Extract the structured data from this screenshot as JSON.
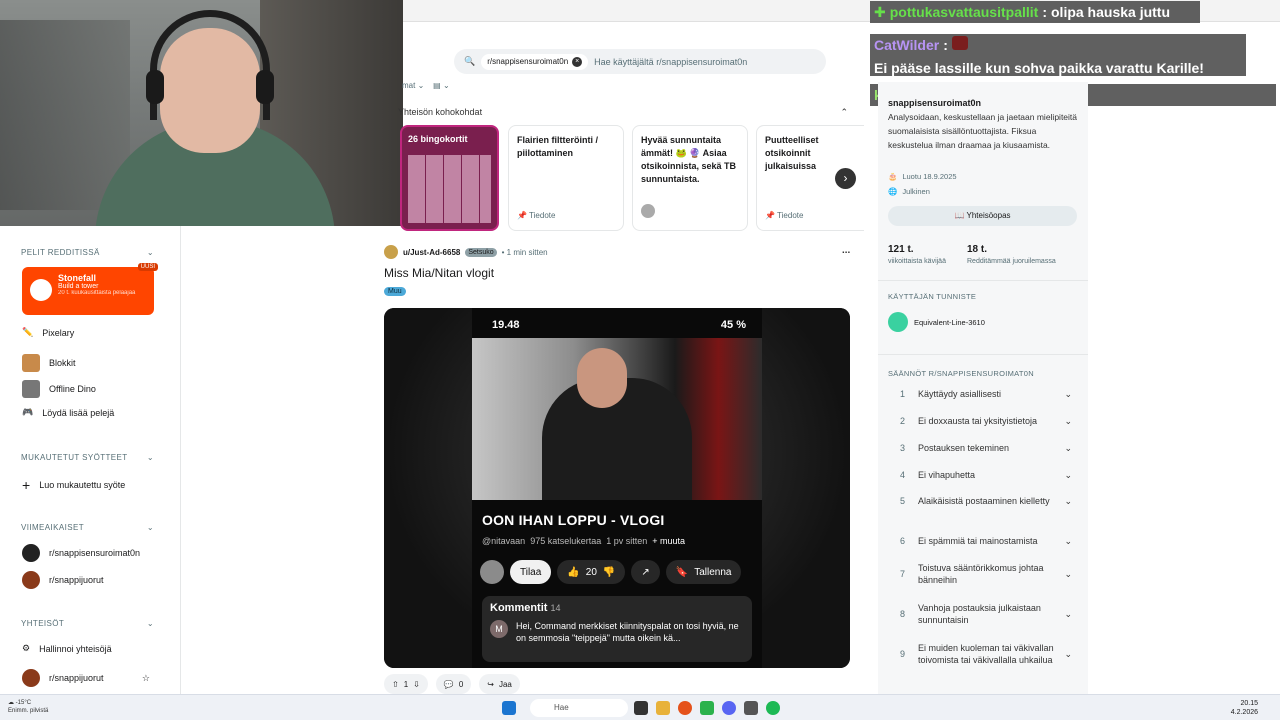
{
  "search": {
    "chip": "r/snappisensuroimat0n",
    "placeholder": "Hae käyttäjältä r/snappisensuroimat0n"
  },
  "chat": [
    {
      "user": "pottukasvattausitpallit",
      "text": "olipa hauska juttu",
      "color": "#66e04a"
    },
    {
      "user": "CatWilder",
      "text": "Ei pääse lassille kun sohva paikka varattu Karille!",
      "color": "#b794f4"
    },
    {
      "user": "kireeanaali",
      "text": "",
      "color": "#9ae66e"
    }
  ],
  "nav": {
    "games_head": "Pelit Redditissä",
    "stonefall": {
      "title": "Stonefall",
      "sub": "Build a tower",
      "count": "20 t. kuukausittaista pelaajaa",
      "badge": "UUSI"
    },
    "games": [
      "Pixelary",
      "Blokkit",
      "Offline Dino",
      "Löydä lisää pelejä"
    ],
    "custom_head": "Mukautetut syötteet",
    "custom_create": "Luo mukautettu syöte",
    "recent_head": "VIIMEAIKAISET",
    "recent": [
      "r/snappisensuroimat0n",
      "r/snappijuorut"
    ],
    "communities_head": "Yhteisöt",
    "communities": [
      "Hallinnoi yhteisöjä",
      "r/snappijuorut"
    ]
  },
  "feed": {
    "sort_label": "mat",
    "highlights_title": "Yhteisön kohokohdat",
    "highlights": [
      {
        "title": "26 bingokortit",
        "foot": ""
      },
      {
        "title": "Flairien filtteröinti / piilottaminen",
        "foot": "Tiedote"
      },
      {
        "title": "Hyvää sunnuntaita ämmät! 🐸 🔮 Asiaa otsikoinnista, sekä TB sunnuntaista.",
        "foot": ""
      },
      {
        "title": "Puutteelliset otsikoinnit julkaisuissa",
        "foot": "Tiedote"
      }
    ],
    "post": {
      "user": "u/Just-Ad-6658",
      "user_flair": "Setsuko",
      "time": "• 1 min sitten",
      "title": "Miss Mia/Nitan vlogit",
      "flair": "Muu",
      "upvotes": "1",
      "comments": "0",
      "share": "Jaa"
    },
    "video": {
      "time": "19.48",
      "battery": "45 %",
      "title": "OON IHAN LOPPU - VLOGI",
      "channel": "@nitavaan",
      "views": "975 katselukertaa",
      "age": "1 pv sitten",
      "more": "+ muuta",
      "subscribe": "Tilaa",
      "likes": "20",
      "save": "Tallenna",
      "comments_label": "Kommentit",
      "comments_count": "14",
      "comment_avatar": "M",
      "comment_text": "Hei, Command merkkiset kiinnityspalat on tosi hyviä, ne on semmosia \"teippejä\" mutta oikein kä..."
    }
  },
  "sidebar": {
    "name": "snappisensuroimat0n",
    "desc": "Analysoidaan, keskustellaan ja jaetaan mielipiteitä suomalaisista sisällöntuottajista. Fiksua keskustelua ilman draamaa ja kiusaamista.",
    "created": "Luotu 18.9.2025",
    "visibility": "Julkinen",
    "guide": "Yhteisöopas",
    "stats": [
      {
        "value": "121 t.",
        "label": "viikoittaista kävijää"
      },
      {
        "value": "18 t.",
        "label": "Redditämmää juoruilemassa"
      }
    ],
    "user_flair_head": "KÄYTTÄJÄN TUNNISTE",
    "user_flair": "Equivalent-Line-3610",
    "rules_head": "SÄÄNNÖT R/SNAPPISENSUROIMAT0N",
    "rules": [
      "Käyttäydy asiallisesti",
      "Ei doxxausta tai yksityistietoja",
      "Postauksen tekeminen",
      "Ei vihapuhetta",
      "Alaikäisistä postaaminen kielletty",
      "Ei spämmiä tai mainostamista",
      "Toistuva sääntörikkomus johtaa bänneihin",
      "Vanhoja postauksia julkaistaan sunnuntaisin",
      "Ei muiden kuoleman tai väkivallan toivomista tai väkivallalla uhkailua"
    ]
  },
  "taskbar": {
    "temp": "-15°C",
    "weather": "Enimm. pilvistä",
    "search": "Hae",
    "time": "20.15",
    "date": "4.2.2026"
  }
}
